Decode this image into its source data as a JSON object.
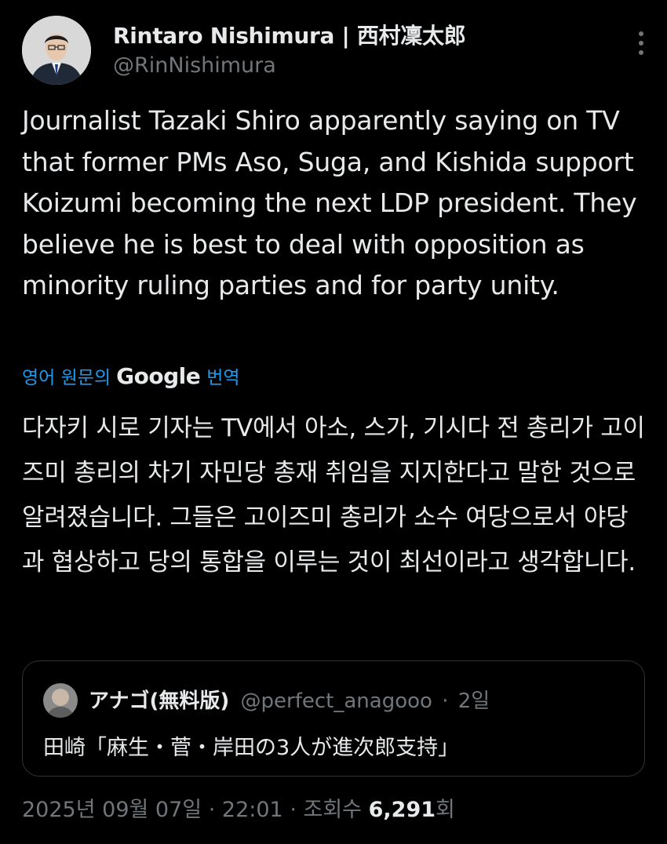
{
  "author": {
    "display_name": "Rintaro Nishimura | 西村凜太郎",
    "handle": "@RinNishimura"
  },
  "tweet": {
    "text": "Journalist Tazaki Shiro apparently saying on TV that former PMs Aso, Suga, and Kishida support Koizumi becoming the next LDP president. They believe he is best to deal with opposition as minority ruling parties and for party unity.",
    "translation_label_prefix": "영어 원문의",
    "translation_provider": "Google",
    "translation_label_suffix": "번역",
    "translated_text": "다자키 시로 기자는 TV에서 아소, 스가, 기시다 전 총리가 고이즈미 총리의 차기 자민당 총재 취임을 지지한다고 말한 것으로 알려졌습니다. 그들은 고이즈미 총리가 소수 여당으로서 야당과 협상하고 당의 통합을 이루는 것이 최선이라고 생각합니다."
  },
  "quote": {
    "display_name": "アナゴ(無料版)",
    "handle": "@perfect_anagooo",
    "separator": "·",
    "time": "2일",
    "text": "田崎「麻生・菅・岸田の3人が進次郎支持」"
  },
  "meta": {
    "date": "2025년 09월 07일",
    "separator": "·",
    "time": "22:01",
    "views_label": "조회수",
    "views_count": "6,291",
    "views_suffix": "회"
  },
  "colors": {
    "background": "#000000",
    "text_primary": "#e7e9ea",
    "text_secondary": "#71767b",
    "link": "#1d9bf0",
    "border": "#2f3336"
  },
  "icons": {
    "more": "more-vertical-icon",
    "avatar": "profile-photo",
    "quote_avatar": "quote-profile-photo"
  }
}
